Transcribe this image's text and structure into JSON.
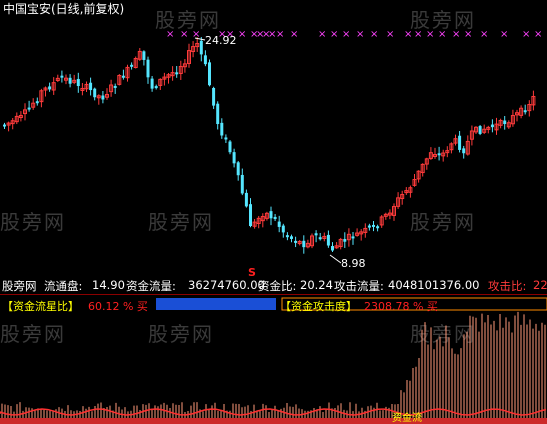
{
  "window": {
    "title": "中国宝安(日线,前复权)"
  },
  "watermarks": [
    "股旁网",
    "股旁网",
    "股旁网",
    "股旁网",
    "股旁网",
    "股旁网",
    "股旁网",
    "股旁网",
    "股旁网"
  ],
  "price_chart": {
    "high_label": "24.92",
    "low_label": "8.98",
    "signal_label": "S"
  },
  "info_bar": {
    "source": "股旁网",
    "float_label": "流通盘:",
    "float_value": "14.90",
    "flow_label": "资金流量:",
    "flow_value": "36274760.00",
    "ratio_label": "资金比:",
    "ratio_value": "20.24",
    "attack_flow_label": "攻击流量:",
    "attack_flow_value": "4048101376.00",
    "attack_ratio_label": "攻击比:",
    "attack_ratio_value": "22"
  },
  "indicator": {
    "left_title": "【资金流星比】",
    "left_value": "60.12 % 买",
    "right_title": "【资金攻击度】",
    "right_value": "2308.78 % 买",
    "bottom_tag": "资金流"
  },
  "colors": {
    "up": "#ff3b3b",
    "down": "#55e6ff",
    "magenta": "#ff44ff",
    "bar": "#ff9a7a",
    "bar_fill": "#cc2a2a",
    "blue_bar": "#1a4fd6",
    "header_bg": "#ff8c00",
    "yellow": "#ffff00"
  }
}
